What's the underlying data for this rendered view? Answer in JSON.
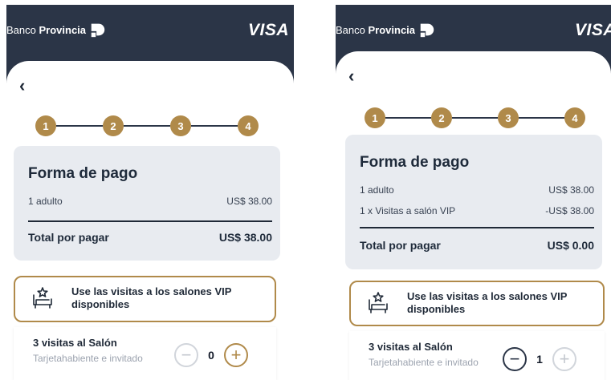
{
  "colors": {
    "header": "#2b3547",
    "accent_gold": "#b08a4a",
    "card": "#e8ebf0"
  },
  "screens": [
    {
      "brand": {
        "prefix": "Banco ",
        "name": "Provincia"
      },
      "card_brand": "VISA",
      "back_label": "‹",
      "steps": [
        "1",
        "2",
        "3",
        "4"
      ],
      "payment": {
        "title": "Forma de pago",
        "rows": [
          {
            "label": "1 adulto",
            "amount": "US$ 38.00"
          }
        ],
        "total_label": "Total por pagar",
        "total_amount": "US$ 38.00"
      },
      "vip_button": {
        "label": "Use las visitas a los salones VIP disponibles",
        "icon": "vip-lounge-icon"
      },
      "visits": {
        "title": "3 visitas al Salón",
        "subtitle": "Tarjetahabiente e invitado",
        "quantity": "0",
        "minus": "−",
        "plus": "+"
      }
    },
    {
      "brand": {
        "prefix": "Banco ",
        "name": "Provincia"
      },
      "card_brand": "VISA",
      "back_label": "‹",
      "steps": [
        "1",
        "2",
        "3",
        "4"
      ],
      "payment": {
        "title": "Forma de pago",
        "rows": [
          {
            "label": "1 adulto",
            "amount": "US$ 38.00"
          },
          {
            "label": "1 x Visitas a salón VIP",
            "amount": "-US$ 38.00"
          }
        ],
        "total_label": "Total por pagar",
        "total_amount": "US$ 0.00"
      },
      "vip_button": {
        "label": "Use las visitas a los salones VIP disponibles",
        "icon": "vip-lounge-icon"
      },
      "visits": {
        "title": "3 visitas al Salón",
        "subtitle": "Tarjetahabiente e invitado",
        "quantity": "1",
        "minus": "−",
        "plus": "+"
      }
    }
  ]
}
